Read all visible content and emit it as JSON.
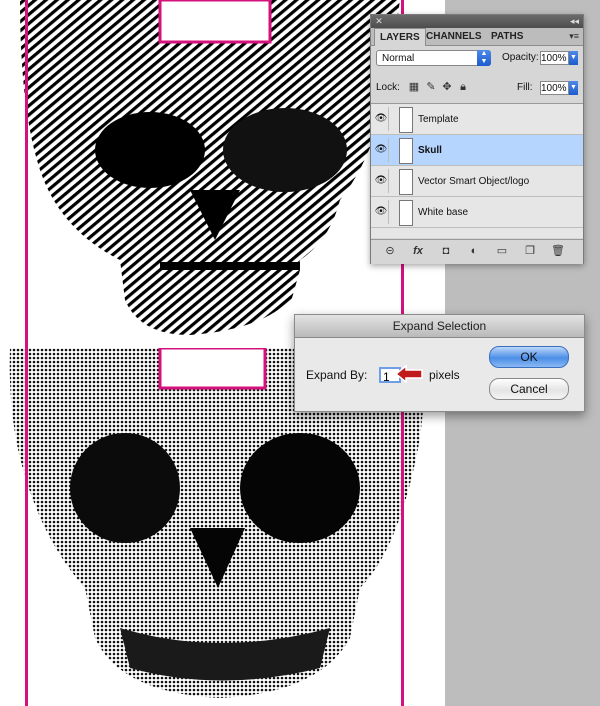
{
  "colors": {
    "guide": "#d4117d",
    "pasteboard": "#bdbdbd",
    "selected_row": "#b5d4fe",
    "arrow": "#c01a1a"
  },
  "canvas": {
    "art_top_icon": "hatched-skull-image",
    "art_bottom_icon": "engraved-skull-image"
  },
  "layers_panel": {
    "tabs": [
      {
        "label": "LAYERS",
        "active": true
      },
      {
        "label": "CHANNELS",
        "active": false
      },
      {
        "label": "PATHS",
        "active": false
      }
    ],
    "blend_mode": "Normal",
    "opacity_label": "Opacity:",
    "opacity_value": "100%",
    "lock_label": "Lock:",
    "fill_label": "Fill:",
    "fill_value": "100%",
    "layers": [
      {
        "name": "Template",
        "visible": true,
        "selected": false
      },
      {
        "name": "Skull",
        "visible": true,
        "selected": true
      },
      {
        "name": "Vector Smart Object/logo",
        "visible": true,
        "selected": false
      },
      {
        "name": "White base",
        "visible": true,
        "selected": false
      }
    ],
    "footer_icons": [
      "link-icon",
      "fx-icon",
      "mask-icon",
      "adjustment-icon",
      "folder-icon",
      "new-layer-icon",
      "trash-icon"
    ]
  },
  "dialog": {
    "title": "Expand Selection",
    "expand_label": "Expand By:",
    "expand_value": "1",
    "units": "pixels",
    "ok_label": "OK",
    "cancel_label": "Cancel"
  }
}
